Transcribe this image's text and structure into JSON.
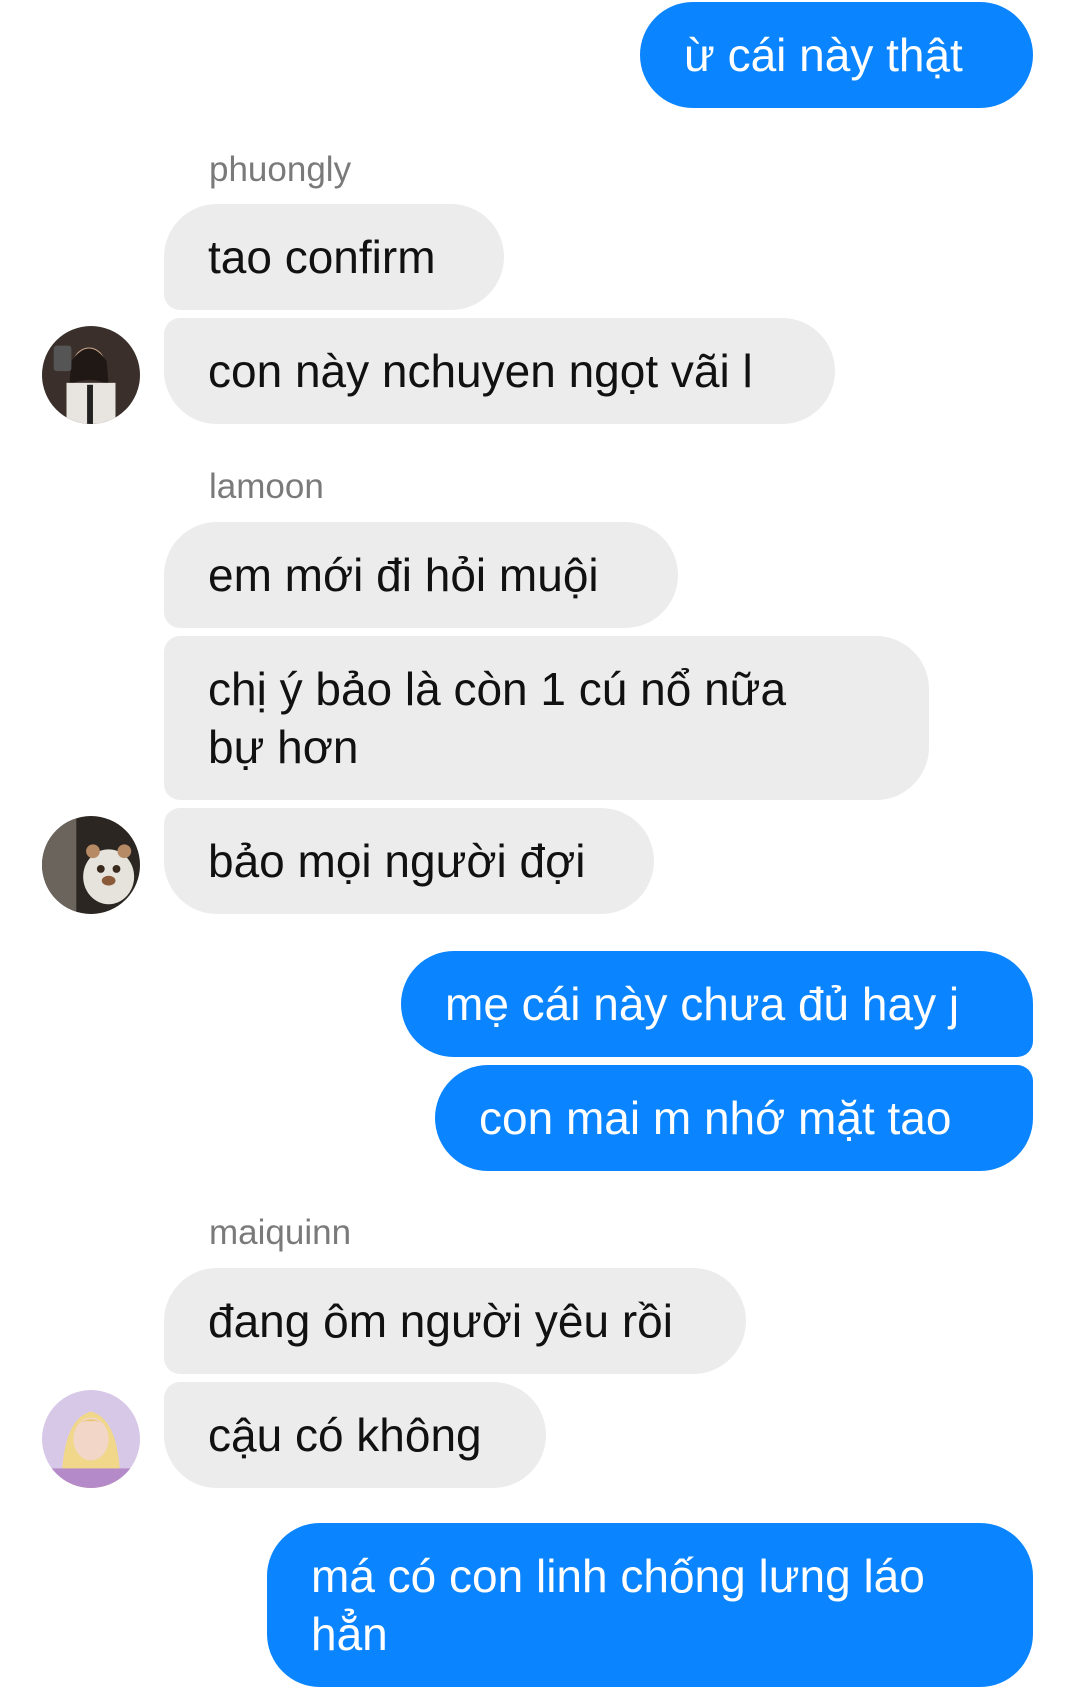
{
  "messages": [
    {
      "text": "ừ cái này thật"
    },
    {
      "sender": "phuongly"
    },
    {
      "text": "tao confirm"
    },
    {
      "text": "con này nchuyen ngọt vãi l"
    },
    {
      "sender": "lamoon"
    },
    {
      "text": "em mới đi hỏi muội"
    },
    {
      "text_line1": "chị ý bảo là còn 1 cú nổ nữa",
      "text_line2": "bự hơn"
    },
    {
      "text": "bảo mọi người đợi"
    },
    {
      "text": "mẹ cái này chưa đủ hay j"
    },
    {
      "text": "con mai m nhớ mặt tao"
    },
    {
      "sender": "maiquinn"
    },
    {
      "text": "đang ôm người yêu rồi"
    },
    {
      "text": "cậu có không"
    },
    {
      "text_line1": "má có con linh chống lưng láo",
      "text_line2": "hẳn"
    }
  ],
  "colors": {
    "outgoing_bubble": "#0a84ff",
    "incoming_bubble": "#ececec",
    "sender_name": "#7a7a7a"
  },
  "avatars": [
    "avatar-phuongly",
    "avatar-lamoon",
    "avatar-maiquinn"
  ]
}
